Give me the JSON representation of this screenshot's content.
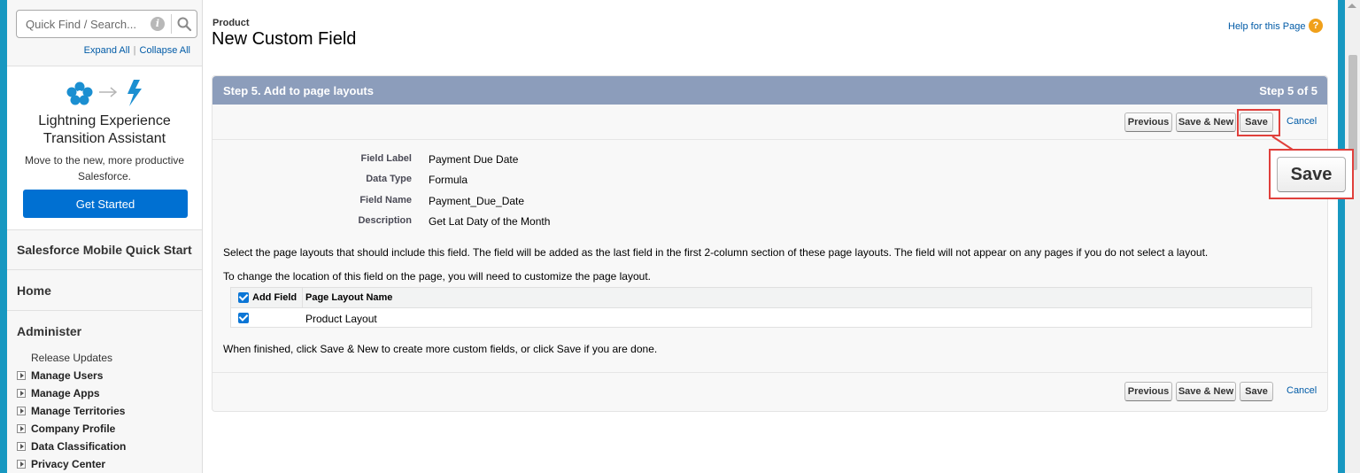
{
  "sidebar": {
    "search_placeholder": "Quick Find / Search...",
    "expand_all": "Expand All",
    "collapse_all": "Collapse All",
    "separator": "|",
    "lex": {
      "title_line1": "Lightning Experience",
      "title_line2": "Transition Assistant",
      "desc_line1": "Move to the new, more productive",
      "desc_line2": "Salesforce.",
      "button": "Get Started"
    },
    "sections": [
      "Salesforce Mobile Quick Start",
      "Home",
      "Administer"
    ],
    "admin_items": [
      {
        "label": "Release Updates",
        "expandable": false
      },
      {
        "label": "Manage Users",
        "expandable": true
      },
      {
        "label": "Manage Apps",
        "expandable": true
      },
      {
        "label": "Manage Territories",
        "expandable": true
      },
      {
        "label": "Company Profile",
        "expandable": true
      },
      {
        "label": "Data Classification",
        "expandable": true
      },
      {
        "label": "Privacy Center",
        "expandable": true
      }
    ]
  },
  "header": {
    "object": "Product",
    "title": "New Custom Field",
    "help": "Help for this Page",
    "help_icon": "?"
  },
  "step": {
    "title": "Step 5. Add to page layouts",
    "count": "Step 5 of 5"
  },
  "buttons": {
    "previous": "Previous",
    "save_new": "Save & New",
    "save": "Save",
    "cancel": "Cancel"
  },
  "details": [
    {
      "label": "Field Label",
      "value": "Payment Due Date"
    },
    {
      "label": "Data Type",
      "value": "Formula"
    },
    {
      "label": "Field Name",
      "value": "Payment_Due_Date"
    },
    {
      "label": "Description",
      "value": "Get Lat Daty of the Month"
    }
  ],
  "info1": "Select the page layouts that should include this field. The field will be added as the last field in the first 2-column section of these page layouts. The field will not appear on any pages if you do not select a layout.",
  "info2": "To change the location of this field on the page, you will need to customize the page layout.",
  "info3": "When finished, click Save & New to create more custom fields, or click Save if you are done.",
  "layout_table": {
    "headers": [
      "Add Field",
      "Page Layout Name"
    ],
    "rows": [
      {
        "checked": true,
        "name": "Product Layout"
      }
    ]
  },
  "zoom_save": "Save",
  "colors": {
    "accent": "#0070d2",
    "step_header": "#8c9dbb",
    "highlight": "#e0403c",
    "frame": "#1798c1"
  }
}
